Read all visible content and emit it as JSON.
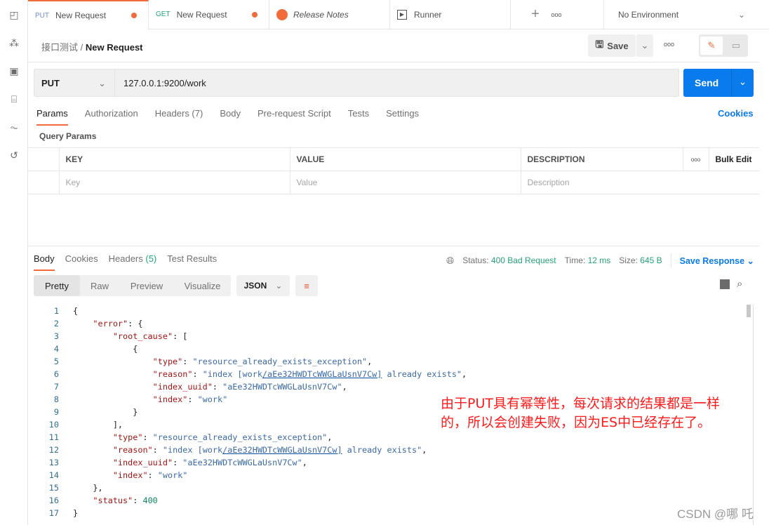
{
  "sidebar": {
    "icons": [
      "new-file-icon",
      "apis-icon",
      "environment-icon",
      "mock-server-icon",
      "monitor-icon",
      "history-icon"
    ]
  },
  "tabs": [
    {
      "method": "PUT",
      "label": "New Request",
      "method_color": "#6a8fd6",
      "unsaved": true
    },
    {
      "method": "GET",
      "label": "New Request",
      "method_color": "#26a17a",
      "unsaved": true
    },
    {
      "label": "Release Notes"
    },
    {
      "label": "Runner"
    }
  ],
  "environment": "No Environment",
  "breadcrumb": {
    "parent": "接口测试",
    "current": "New Request"
  },
  "toolbar": {
    "save_label": "Save"
  },
  "request": {
    "method": "PUT",
    "url": "127.0.0.1:9200/work",
    "send_label": "Send"
  },
  "request_tabs": [
    "Params",
    "Authorization",
    "Headers (7)",
    "Body",
    "Pre-request Script",
    "Tests",
    "Settings"
  ],
  "cookies_label": "Cookies",
  "query_params": {
    "title": "Query Params",
    "headers": [
      "KEY",
      "VALUE",
      "DESCRIPTION"
    ],
    "bulk_edit": "Bulk Edit",
    "placeholders": [
      "Key",
      "Value",
      "Description"
    ]
  },
  "response": {
    "tabs": [
      "Body",
      "Cookies",
      "Headers",
      "Test Results"
    ],
    "headers_count": "(5)",
    "status_label": "Status:",
    "status": "400 Bad Request",
    "time_label": "Time:",
    "time": "12 ms",
    "size_label": "Size:",
    "size": "645 B",
    "save_response": "Save Response",
    "view_modes": [
      "Pretty",
      "Raw",
      "Preview",
      "Visualize"
    ],
    "format": "JSON"
  },
  "code_lines": [
    [
      {
        "t": "{"
      }
    ],
    [
      {
        "t": "    "
      },
      {
        "t": "\"error\"",
        "c": "k"
      },
      {
        "t": ": {"
      }
    ],
    [
      {
        "t": "        "
      },
      {
        "t": "\"root_cause\"",
        "c": "k"
      },
      {
        "t": ": ["
      }
    ],
    [
      {
        "t": "            {"
      }
    ],
    [
      {
        "t": "                "
      },
      {
        "t": "\"type\"",
        "c": "k"
      },
      {
        "t": ": "
      },
      {
        "t": "\"resource_already_exists_exception\"",
        "c": "s"
      },
      {
        "t": ","
      }
    ],
    [
      {
        "t": "                "
      },
      {
        "t": "\"reason\"",
        "c": "k"
      },
      {
        "t": ": "
      },
      {
        "t": "\"index [work",
        "c": "s"
      },
      {
        "t": "/aEe32HWDTcWWGLaUsnV7Cw]",
        "c": "s u"
      },
      {
        "t": " already exists\"",
        "c": "s"
      },
      {
        "t": ","
      }
    ],
    [
      {
        "t": "                "
      },
      {
        "t": "\"index_uuid\"",
        "c": "k"
      },
      {
        "t": ": "
      },
      {
        "t": "\"aEe32HWDTcWWGLaUsnV7Cw\"",
        "c": "s"
      },
      {
        "t": ","
      }
    ],
    [
      {
        "t": "                "
      },
      {
        "t": "\"index\"",
        "c": "k"
      },
      {
        "t": ": "
      },
      {
        "t": "\"work\"",
        "c": "s"
      }
    ],
    [
      {
        "t": "            }"
      }
    ],
    [
      {
        "t": "        ],"
      }
    ],
    [
      {
        "t": "        "
      },
      {
        "t": "\"type\"",
        "c": "k"
      },
      {
        "t": ": "
      },
      {
        "t": "\"resource_already_exists_exception\"",
        "c": "s"
      },
      {
        "t": ","
      }
    ],
    [
      {
        "t": "        "
      },
      {
        "t": "\"reason\"",
        "c": "k"
      },
      {
        "t": ": "
      },
      {
        "t": "\"index [work",
        "c": "s"
      },
      {
        "t": "/aEe32HWDTcWWGLaUsnV7Cw]",
        "c": "s u"
      },
      {
        "t": " already exists\"",
        "c": "s"
      },
      {
        "t": ","
      }
    ],
    [
      {
        "t": "        "
      },
      {
        "t": "\"index_uuid\"",
        "c": "k"
      },
      {
        "t": ": "
      },
      {
        "t": "\"aEe32HWDTcWWGLaUsnV7Cw\"",
        "c": "s"
      },
      {
        "t": ","
      }
    ],
    [
      {
        "t": "        "
      },
      {
        "t": "\"index\"",
        "c": "k"
      },
      {
        "t": ": "
      },
      {
        "t": "\"work\"",
        "c": "s"
      }
    ],
    [
      {
        "t": "    },"
      }
    ],
    [
      {
        "t": "    "
      },
      {
        "t": "\"status\"",
        "c": "k"
      },
      {
        "t": ": "
      },
      {
        "t": "400",
        "c": "n"
      }
    ],
    [
      {
        "t": "}"
      }
    ]
  ],
  "annotation": "由于PUT具有幂等性，每次请求的结果都是一样的，所以会创建失败，因为ES中已经存在了。",
  "watermark": "CSDN @哪 吒",
  "colors": {
    "accent": "#f26b3a",
    "primary": "#097bed",
    "status_ok": "#26a17a",
    "annotation": "#ff1a1a"
  }
}
